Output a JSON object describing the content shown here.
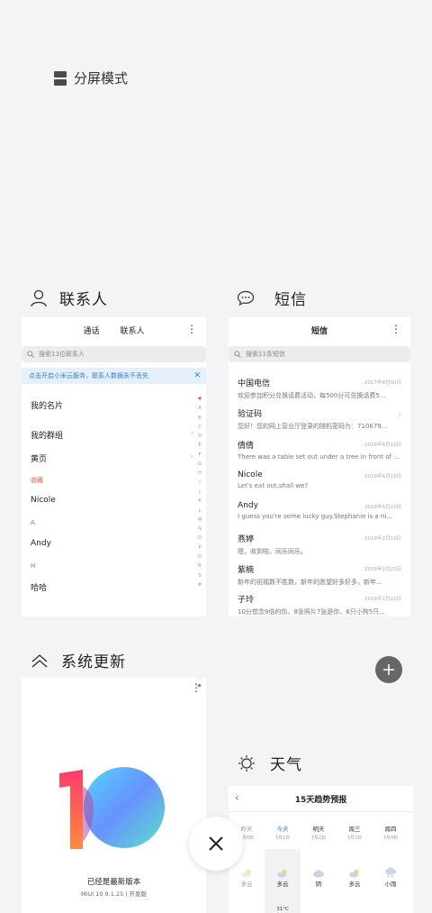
{
  "split_mode": {
    "label": "分屏模式"
  },
  "contacts": {
    "title": "联系人",
    "tabs": [
      "通话",
      "联系人"
    ],
    "search_placeholder": "搜索13位联系人",
    "banner": "点击开启小米云服务，联系人数据永不丢失",
    "rows": [
      "我的名片",
      "我的群组",
      "黄页"
    ],
    "section_fav": "收藏",
    "fav_name": "Nicole",
    "section_a": "A",
    "a_name": "Andy",
    "section_h": "H",
    "h_name": "哈哈",
    "alphabet": [
      "♥",
      "A",
      "B",
      "C",
      "D",
      "E",
      "F",
      "G",
      "H",
      "I",
      "J",
      "K",
      "L",
      "M",
      "N",
      "O",
      "P",
      "Q",
      "R",
      "S",
      "#"
    ]
  },
  "sms": {
    "title": "短信",
    "header": "短信",
    "search_placeholder": "搜索11条短信",
    "messages": [
      {
        "name": "中国电信",
        "date": "2017年8月30日",
        "preview": "欢迎参加积分兑换话费活动，每500分可兑换话费5..."
      },
      {
        "name": "验证码",
        "date": "",
        "preview": "您好！您的网上营业厅登录的随机密码为：710679..."
      },
      {
        "name": "倩倩",
        "date": "2018年6月13日",
        "preview": "There was a table set out under a tree in front of ..."
      },
      {
        "name": "Nicole",
        "date": "2018年6月13日",
        "preview": "Let's eat out,shall we?"
      },
      {
        "name": "Andy",
        "date": "2018年6月13日",
        "preview": "I guess you're some lucky guy.Stephanie is a ni..."
      },
      {
        "name": "燕婷",
        "date": "2018年2月22日",
        "preview": "嗯，收到啦。同乐同乐。"
      },
      {
        "name": "紫楠",
        "date": "2018年2月22日",
        "preview": "新年的祝福数不胜数，新年的愿望好多好多，新年..."
      },
      {
        "name": "子玲",
        "date": "2018年2月22日",
        "preview": "10分想念9倍的你，8张照片7张是你，6只小狗5只..."
      }
    ]
  },
  "updater": {
    "title": "系统更新",
    "status": "已经是最新版本",
    "version": "MIUI 10 9.1.25 | 开发版"
  },
  "weather": {
    "title": "天气",
    "header": "15天趋势预报",
    "days": [
      {
        "day": "昨天",
        "date": "7月0日",
        "cond": "多云"
      },
      {
        "day": "今天",
        "date": "7月1日",
        "cond": "多云"
      },
      {
        "day": "明天",
        "date": "7月2日",
        "cond": "阴"
      },
      {
        "day": "周三",
        "date": "7月3日",
        "cond": "多云"
      },
      {
        "day": "周四",
        "date": "7月4日",
        "cond": "小雨"
      }
    ],
    "temp": "31°C"
  },
  "colors": {
    "accent": "#2f7de0",
    "section": "#f05c3b",
    "fab": "#666666"
  }
}
